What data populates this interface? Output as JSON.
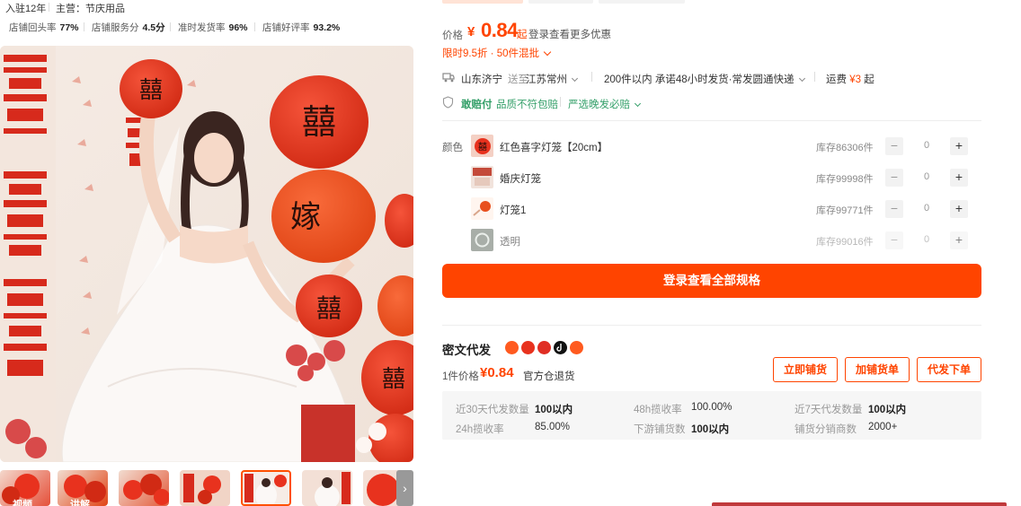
{
  "shop": {
    "years": "入驻12年",
    "main_category": "主营：节庆用品",
    "stats": [
      {
        "label": "店铺回头率",
        "value": "77%"
      },
      {
        "label": "店铺服务分",
        "value": "4.5分"
      },
      {
        "label": "准时发货率",
        "value": "96%"
      },
      {
        "label": "店铺好评率",
        "value": "93.2%"
      }
    ]
  },
  "gallery": {
    "thumbs": [
      {
        "label": "视频"
      },
      {
        "label": "讲解"
      },
      {
        "label": ""
      },
      {
        "label": ""
      },
      {
        "label": ""
      },
      {
        "label": ""
      },
      {
        "label": ""
      }
    ],
    "next_arrow": "›",
    "photo_lantern_chars": [
      "囍",
      "囍",
      "囍",
      "囍",
      "嫁",
      "囍"
    ]
  },
  "price": {
    "label": "价格",
    "currency": "¥",
    "value": "0.84",
    "suffix": "起",
    "login_hint": "登录查看更多优惠"
  },
  "promo": {
    "text": "限时9.5折 · 50件混批"
  },
  "shipping": {
    "from": "山东济宁",
    "to_label": "送至",
    "to": "江苏常州",
    "promise": "200件以内  承诺48小时发货·常发圆通快递",
    "fee_label": "运费",
    "fee_value": "¥3",
    "fee_suffix": "起"
  },
  "guarantee": {
    "name": "敢赔付",
    "desc": "品质不符包赔",
    "extra": "严选晚发必赔"
  },
  "specs": {
    "label": "颜色",
    "items": [
      {
        "name": "红色喜字灯笼【20cm】",
        "stock": "库存86306件",
        "qty": "0"
      },
      {
        "name": "婚庆灯笼",
        "stock": "库存99998件",
        "qty": "0"
      },
      {
        "name": "灯笼1",
        "stock": "库存99771件",
        "qty": "0"
      },
      {
        "name": "透明",
        "stock": "库存99016件",
        "qty": "0"
      }
    ],
    "minus": "−",
    "plus": "+"
  },
  "login_button": "登录查看全部规格",
  "dropship": {
    "title": "密文代发",
    "icon_names": [
      "taobao-icon",
      "tmall-icon",
      "pdd-icon",
      "douyin-icon",
      "kuaishou-icon"
    ],
    "price_label": "1件价格",
    "price": "¥0.84",
    "return_note": "官方仓退货",
    "buttons": [
      "立即铺货",
      "加铺货单",
      "代发下单"
    ],
    "metrics": [
      {
        "label": "近30天代发数量",
        "value": "100以内",
        "bold": true
      },
      {
        "label": "48h揽收率",
        "value": "100.00%",
        "bold": false
      },
      {
        "label": "近7天代发数量",
        "value": "100以内",
        "bold": true
      },
      {
        "label": "24h揽收率",
        "value": "85.00%",
        "bold": false
      },
      {
        "label": "下游铺货数",
        "value": "100以内",
        "bold": true
      },
      {
        "label": "铺货分销商数",
        "value": "2000+",
        "bold": false
      }
    ]
  },
  "colors": {
    "accent": "#ff4400",
    "green": "#35a06a",
    "lantern_red": "#e8321e"
  }
}
